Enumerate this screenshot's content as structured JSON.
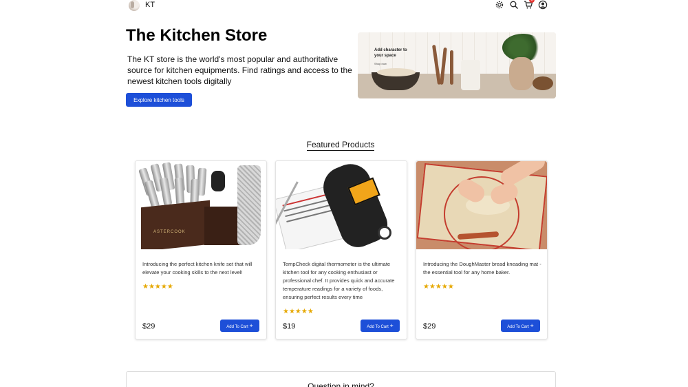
{
  "header": {
    "brand": "KT",
    "icons": [
      "gear-icon",
      "search-icon",
      "cart-icon",
      "user-icon"
    ],
    "cart_count": "0"
  },
  "hero": {
    "title": "The Kitchen Store",
    "description": "The KT store is the world's most popular and authoritative source for kitchen equipments. Find ratings and access to the newest kitchen tools digitally",
    "button_label": "Explore kitchen tools",
    "image_caption": "Add character to your space",
    "image_sub": "Shop now"
  },
  "featured": {
    "title": "Featured Products",
    "products": [
      {
        "description": "Introducing the perfect kitchen knife set that will elevate your cooking skills to the next level!",
        "rating": "★★★★★",
        "price": "$29",
        "cart_label": "Add To Cart",
        "image_label": "ASTERCOOK"
      },
      {
        "description": "TempCheck digital thermometer is the ultimate kitchen tool for any cooking enthusiast or professional chef. It provides quick and accurate temperature readings for a variety of foods, ensuring perfect results every time",
        "rating": "★★★★★",
        "price": "$19",
        "cart_label": "Add To Cart"
      },
      {
        "description": "Introducing the DoughMaster bread kneading mat - the essential tool for any home baker.",
        "rating": "★★★★★",
        "price": "$29",
        "cart_label": "Add To Cart"
      }
    ]
  },
  "question": {
    "title": "Question in mind?"
  },
  "colors": {
    "accent": "#1d4fd8",
    "star": "#e6a800",
    "badge": "#e53935"
  }
}
